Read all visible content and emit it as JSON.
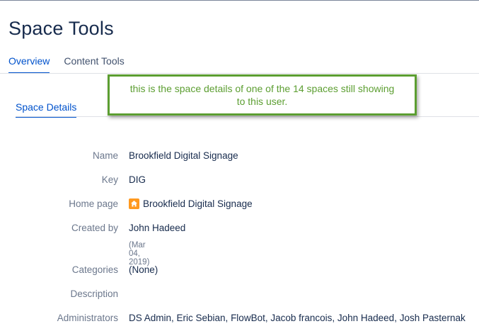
{
  "page": {
    "title": "Space Tools"
  },
  "tabs": {
    "items": [
      {
        "label": "Overview",
        "active": true
      },
      {
        "label": "Content Tools",
        "active": false
      }
    ]
  },
  "subtabs": {
    "items": [
      {
        "label": "Space Details",
        "active": true
      }
    ]
  },
  "callout": {
    "text": "this is the space details of one of the 14 spaces still showing to this user.",
    "color": "#5c9e31"
  },
  "details": {
    "name_label": "Name",
    "name_value": "Brookfield Digital Signage",
    "key_label": "Key",
    "key_value": "DIG",
    "homepage_label": "Home page",
    "homepage_value": "Brookfield Digital Signage",
    "homepage_icon": "home-icon",
    "created_label": "Created by",
    "created_value": "John Hadeed",
    "created_date": "(Mar 04, 2019)",
    "categories_label": "Categories",
    "categories_value": "(None)",
    "description_label": "Description",
    "description_value": "",
    "admins_label": "Administrators",
    "admins_value": "DS Admin, Eric Sebian, FlowBot, Jacob francois, John Hadeed, Josh Pasternak"
  },
  "colors": {
    "accent": "#0052cc",
    "text": "#172b4d",
    "muted": "#6b778c",
    "icon": "#ff991f"
  }
}
